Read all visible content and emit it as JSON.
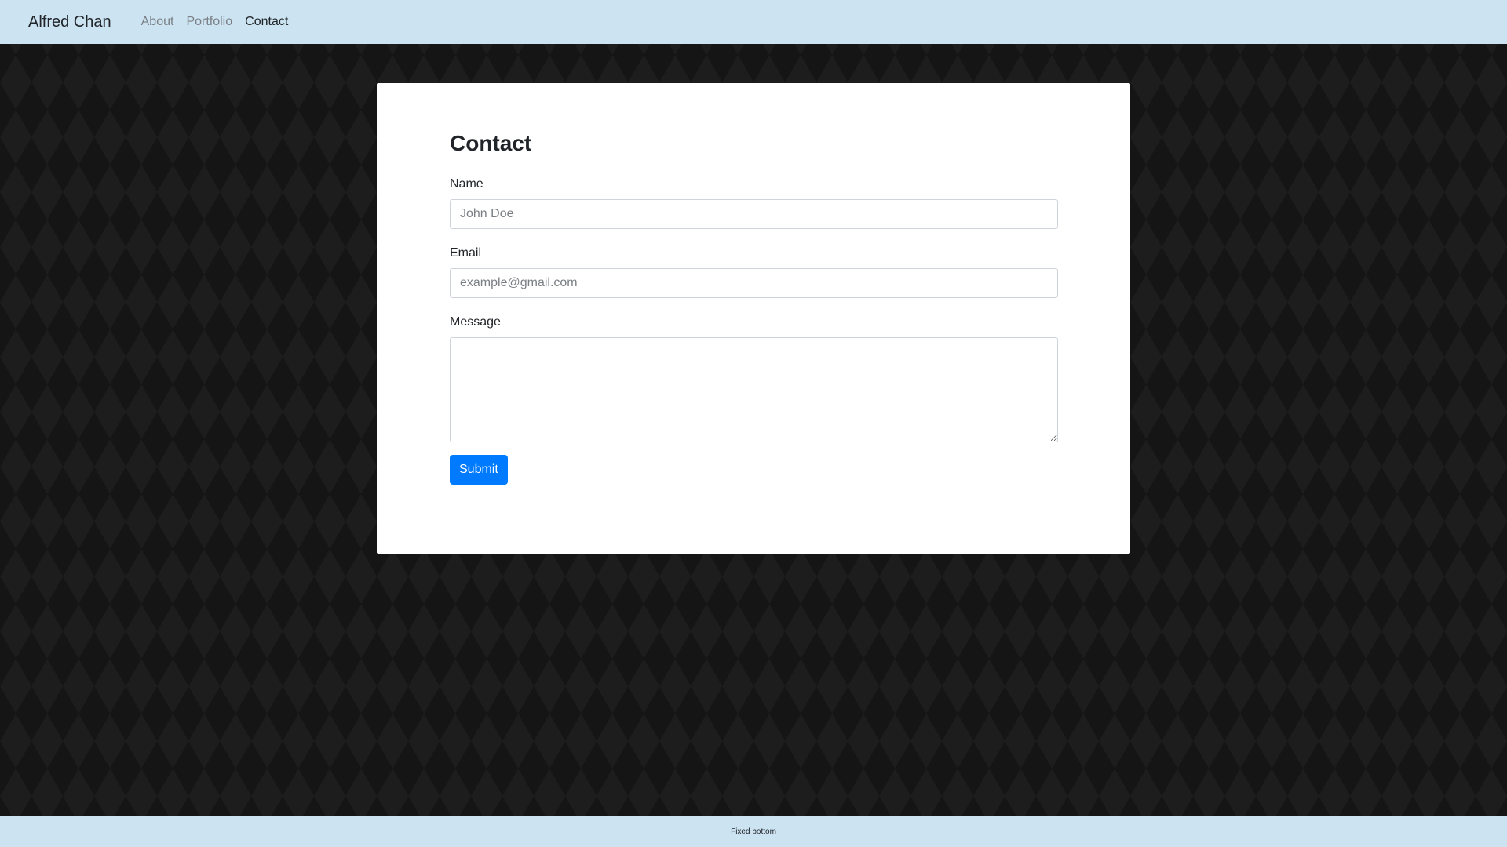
{
  "navbar": {
    "brand": "Alfred Chan",
    "links": [
      {
        "label": "About"
      },
      {
        "label": "Portfolio"
      },
      {
        "label": "Contact"
      }
    ],
    "background_color": "#cce3f2"
  },
  "contact_form": {
    "title": "Contact",
    "name": {
      "label": "Name",
      "placeholder": "John Doe",
      "value": ""
    },
    "email": {
      "label": "Email",
      "placeholder": "example@gmail.com",
      "value": ""
    },
    "message": {
      "label": "Message",
      "placeholder": "",
      "value": ""
    },
    "submit_label": "Submit",
    "submit_color": "#007bff"
  },
  "footer": {
    "text": "Fixed bottom"
  }
}
